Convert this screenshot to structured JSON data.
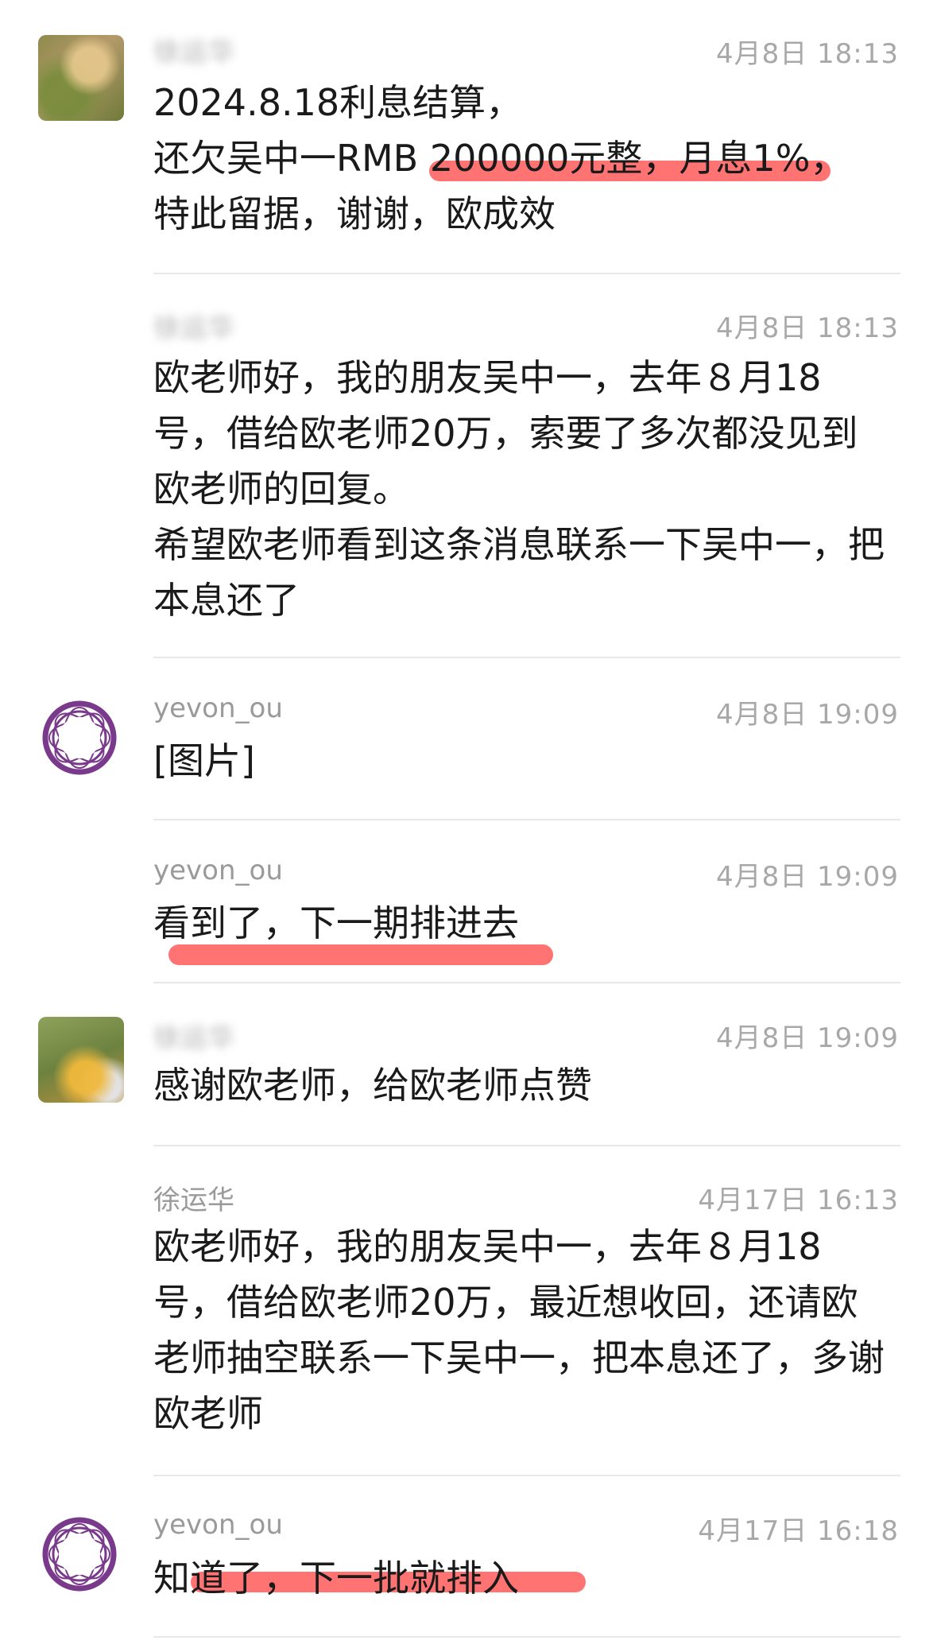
{
  "messages": [
    {
      "author": "徐运华",
      "time": "4月8日 18:13",
      "text": "2024.8.18利息结算，\n还欠吴中一RMB 200000元整，月息1%，\n特此留据，谢谢，欧成效"
    },
    {
      "author": "徐运华",
      "time": "4月8日 18:13",
      "text": "欧老师好，我的朋友吴中一，去年８月18号，借给欧老师20万，索要了多次都没见到欧老师的回复。\n希望欧老师看到这条消息联系一下吴中一，把本息还了"
    },
    {
      "author": "yevon_ou",
      "time": "4月8日 19:09",
      "text": "[图片]"
    },
    {
      "author": "yevon_ou",
      "time": "4月8日 19:09",
      "text": "看到了，下一期排进去"
    },
    {
      "author": "徐运华",
      "time": "4月8日 19:09",
      "text": "感谢欧老师，给欧老师点赞"
    },
    {
      "author": "徐运华",
      "time": "4月17日 16:13",
      "text": "欧老师好，我的朋友吴中一，去年８月18号，借给欧老师20万，最近想收回，还请欧老师抽空联系一下吴中一，把本息还了，多谢欧老师"
    },
    {
      "author": "yevon_ou",
      "time": "4月17日 16:18",
      "text": "知道了，下一批就排入"
    }
  ],
  "colors": {
    "highlight": "#ff5a5a",
    "ring_avatar": "#7a3a8c"
  }
}
